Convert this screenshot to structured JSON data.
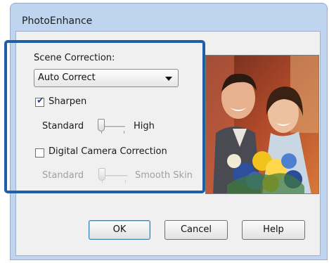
{
  "window": {
    "title": "PhotoEnhance"
  },
  "scene_correction": {
    "label": "Scene Correction:",
    "selected": "Auto Correct"
  },
  "sharpen": {
    "label": "Sharpen",
    "checked": true,
    "min_label": "Standard",
    "max_label": "High",
    "level": 0
  },
  "digital_camera_correction": {
    "label": "Digital Camera Correction",
    "checked": false,
    "enabled": false,
    "min_label": "Standard",
    "max_label": "Smooth Skin",
    "level": 0
  },
  "buttons": {
    "ok": "OK",
    "cancel": "Cancel",
    "help": "Help"
  },
  "colors": {
    "highlight_border": "#1f5fa8",
    "title_bar": "#bfd4ee"
  }
}
